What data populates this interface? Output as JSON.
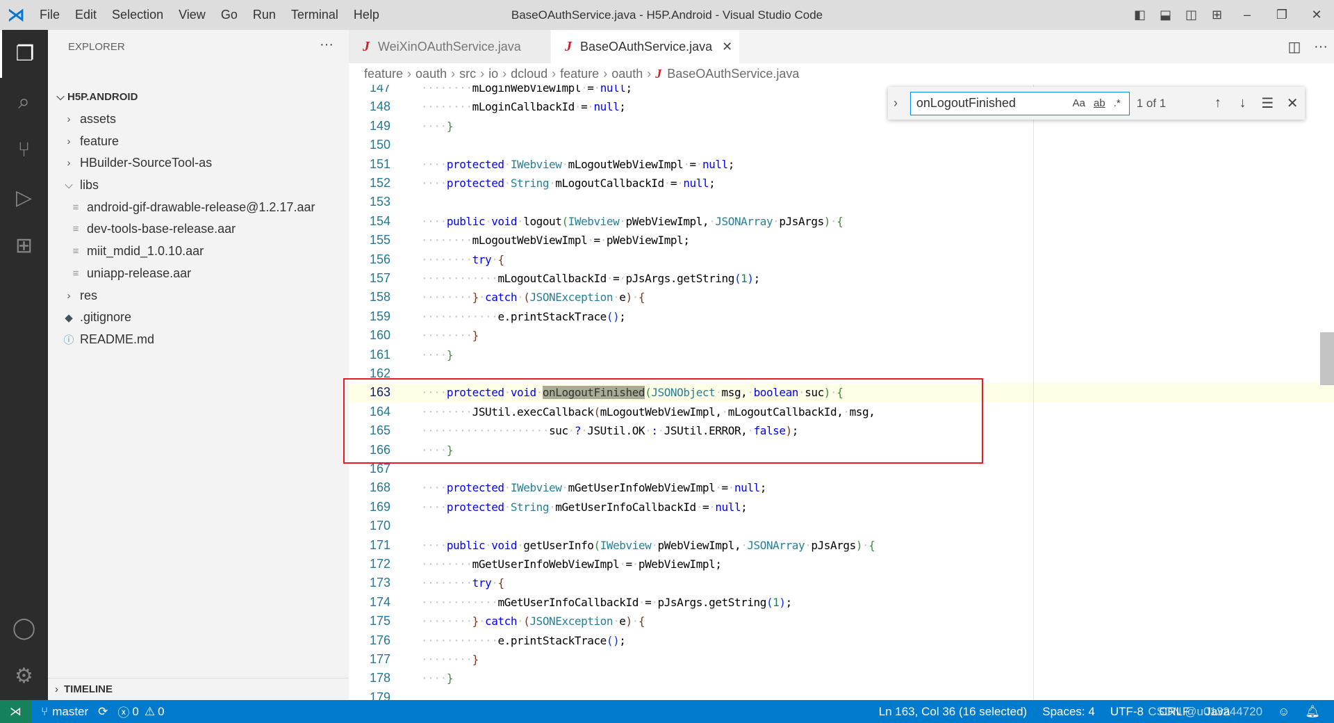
{
  "window": {
    "title": "BaseOAuthService.java - H5P.Android - Visual Studio Code",
    "menu": [
      "File",
      "Edit",
      "Selection",
      "View",
      "Go",
      "Run",
      "Terminal",
      "Help"
    ]
  },
  "sidebar": {
    "header": "EXPLORER",
    "root": "H5P.ANDROID",
    "items": [
      {
        "label": "assets",
        "type": "folder",
        "expanded": false,
        "depth": 1
      },
      {
        "label": "feature",
        "type": "folder",
        "expanded": false,
        "depth": 1
      },
      {
        "label": "HBuilder-SourceTool-as",
        "type": "folder",
        "expanded": false,
        "depth": 1
      },
      {
        "label": "libs",
        "type": "folder",
        "expanded": true,
        "depth": 1
      },
      {
        "label": "android-gif-drawable-release@1.2.17.aar",
        "type": "file",
        "depth": 2
      },
      {
        "label": "dev-tools-base-release.aar",
        "type": "file",
        "depth": 2
      },
      {
        "label": "miit_mdid_1.0.10.aar",
        "type": "file",
        "depth": 2
      },
      {
        "label": "uniapp-release.aar",
        "type": "file",
        "depth": 2
      },
      {
        "label": "res",
        "type": "folder",
        "expanded": false,
        "depth": 1
      },
      {
        "label": ".gitignore",
        "type": "git",
        "depth": 1
      },
      {
        "label": "README.md",
        "type": "info",
        "depth": 1
      }
    ],
    "timeline": "TIMELINE"
  },
  "tabs": [
    {
      "label": "WeiXinOAuthService.java",
      "active": false
    },
    {
      "label": "BaseOAuthService.java",
      "active": true
    }
  ],
  "breadcrumb": [
    "feature",
    "oauth",
    "src",
    "io",
    "dcloud",
    "feature",
    "oauth",
    "BaseOAuthService.java"
  ],
  "find": {
    "value": "onLogoutFinished",
    "match_case": "Aa",
    "whole_word": "ab",
    "regex": ".*",
    "count": "1 of 1"
  },
  "editor": {
    "current_line": 163,
    "lines": [
      {
        "n": 147,
        "t": [
          [
            "ws",
            "        "
          ],
          [
            "p",
            "mLoginWebViewImpl = "
          ],
          [
            "k",
            "null"
          ],
          [
            "p",
            ";"
          ]
        ]
      },
      {
        "n": 148,
        "t": [
          [
            "ws",
            "        "
          ],
          [
            "p",
            "mLoginCallbackId = "
          ],
          [
            "k",
            "null"
          ],
          [
            "p",
            ";"
          ]
        ]
      },
      {
        "n": 149,
        "t": [
          [
            "ws",
            "    "
          ],
          [
            "b2",
            "}"
          ]
        ]
      },
      {
        "n": 150,
        "t": []
      },
      {
        "n": 151,
        "t": [
          [
            "ws",
            "    "
          ],
          [
            "k",
            "protected"
          ],
          [
            "p",
            " "
          ],
          [
            "t",
            "IWebview"
          ],
          [
            "p",
            " mLogoutWebViewImpl = "
          ],
          [
            "k",
            "null"
          ],
          [
            "p",
            ";"
          ]
        ]
      },
      {
        "n": 152,
        "t": [
          [
            "ws",
            "    "
          ],
          [
            "k",
            "protected"
          ],
          [
            "p",
            " "
          ],
          [
            "t",
            "String"
          ],
          [
            "p",
            " mLogoutCallbackId = "
          ],
          [
            "k",
            "null"
          ],
          [
            "p",
            ";"
          ]
        ]
      },
      {
        "n": 153,
        "t": []
      },
      {
        "n": 154,
        "t": [
          [
            "ws",
            "    "
          ],
          [
            "k",
            "public"
          ],
          [
            "p",
            " "
          ],
          [
            "k",
            "void"
          ],
          [
            "p",
            " logout"
          ],
          [
            "b2",
            "("
          ],
          [
            "t",
            "IWebview"
          ],
          [
            "p",
            " pWebViewImpl, "
          ],
          [
            "t",
            "JSONArray"
          ],
          [
            "p",
            " pJsArgs"
          ],
          [
            "b2",
            ")"
          ],
          [
            "p",
            " "
          ],
          [
            "b2",
            "{"
          ]
        ]
      },
      {
        "n": 155,
        "t": [
          [
            "ws",
            "        "
          ],
          [
            "p",
            "mLogoutWebViewImpl = pWebViewImpl;"
          ]
        ]
      },
      {
        "n": 156,
        "t": [
          [
            "ws",
            "        "
          ],
          [
            "k",
            "try"
          ],
          [
            "p",
            " "
          ],
          [
            "b3",
            "{"
          ]
        ]
      },
      {
        "n": 157,
        "t": [
          [
            "ws",
            "            "
          ],
          [
            "p",
            "mLogoutCallbackId = pJsArgs.getString"
          ],
          [
            "b1",
            "("
          ],
          [
            "n",
            "1"
          ],
          [
            "b1",
            ")"
          ],
          [
            "p",
            ";"
          ]
        ]
      },
      {
        "n": 158,
        "t": [
          [
            "ws",
            "        "
          ],
          [
            "b3",
            "}"
          ],
          [
            "p",
            " "
          ],
          [
            "k",
            "catch"
          ],
          [
            "p",
            " "
          ],
          [
            "b3",
            "("
          ],
          [
            "t",
            "JSONException"
          ],
          [
            "p",
            " e"
          ],
          [
            "b3",
            ")"
          ],
          [
            "p",
            " "
          ],
          [
            "b3",
            "{"
          ]
        ]
      },
      {
        "n": 159,
        "t": [
          [
            "ws",
            "            "
          ],
          [
            "p",
            "e.printStackTrace"
          ],
          [
            "b1",
            "()"
          ],
          [
            "p",
            ";"
          ]
        ]
      },
      {
        "n": 160,
        "t": [
          [
            "ws",
            "        "
          ],
          [
            "b3",
            "}"
          ]
        ]
      },
      {
        "n": 161,
        "t": [
          [
            "ws",
            "    "
          ],
          [
            "b2",
            "}"
          ]
        ]
      },
      {
        "n": 162,
        "t": []
      },
      {
        "n": 163,
        "t": [
          [
            "ws",
            "    "
          ],
          [
            "k",
            "protected"
          ],
          [
            "p",
            " "
          ],
          [
            "k",
            "void"
          ],
          [
            "p",
            " "
          ],
          [
            "h",
            "onLogoutFinished"
          ],
          [
            "b2",
            "("
          ],
          [
            "t",
            "JSONObject"
          ],
          [
            "p",
            " msg, "
          ],
          [
            "k",
            "boolean"
          ],
          [
            "p",
            " suc"
          ],
          [
            "b2",
            ")"
          ],
          [
            "p",
            " "
          ],
          [
            "b2",
            "{"
          ]
        ]
      },
      {
        "n": 164,
        "t": [
          [
            "ws",
            "        "
          ],
          [
            "p",
            "JSUtil.execCallback"
          ],
          [
            "b3",
            "("
          ],
          [
            "p",
            "mLogoutWebViewImpl, mLogoutCallbackId, msg,"
          ]
        ]
      },
      {
        "n": 165,
        "t": [
          [
            "ws",
            "                    "
          ],
          [
            "p",
            "suc "
          ],
          [
            "k",
            "?"
          ],
          [
            "p",
            " JSUtil.OK "
          ],
          [
            "k",
            ":"
          ],
          [
            "p",
            " JSUtil.ERROR, "
          ],
          [
            "k",
            "false"
          ],
          [
            "b3",
            ")"
          ],
          [
            "p",
            ";"
          ]
        ]
      },
      {
        "n": 166,
        "t": [
          [
            "ws",
            "    "
          ],
          [
            "b2",
            "}"
          ]
        ]
      },
      {
        "n": 167,
        "t": []
      },
      {
        "n": 168,
        "t": [
          [
            "ws",
            "    "
          ],
          [
            "k",
            "protected"
          ],
          [
            "p",
            " "
          ],
          [
            "t",
            "IWebview"
          ],
          [
            "p",
            " mGetUserInfoWebViewImpl = "
          ],
          [
            "k",
            "null"
          ],
          [
            "p",
            ";"
          ]
        ]
      },
      {
        "n": 169,
        "t": [
          [
            "ws",
            "    "
          ],
          [
            "k",
            "protected"
          ],
          [
            "p",
            " "
          ],
          [
            "t",
            "String"
          ],
          [
            "p",
            " mGetUserInfoCallbackId = "
          ],
          [
            "k",
            "null"
          ],
          [
            "p",
            ";"
          ]
        ]
      },
      {
        "n": 170,
        "t": []
      },
      {
        "n": 171,
        "t": [
          [
            "ws",
            "    "
          ],
          [
            "k",
            "public"
          ],
          [
            "p",
            " "
          ],
          [
            "k",
            "void"
          ],
          [
            "p",
            " getUserInfo"
          ],
          [
            "b2",
            "("
          ],
          [
            "t",
            "IWebview"
          ],
          [
            "p",
            " pWebViewImpl, "
          ],
          [
            "t",
            "JSONArray"
          ],
          [
            "p",
            " pJsArgs"
          ],
          [
            "b2",
            ")"
          ],
          [
            "p",
            " "
          ],
          [
            "b2",
            "{"
          ]
        ]
      },
      {
        "n": 172,
        "t": [
          [
            "ws",
            "        "
          ],
          [
            "p",
            "mGetUserInfoWebViewImpl = pWebViewImpl;"
          ]
        ]
      },
      {
        "n": 173,
        "t": [
          [
            "ws",
            "        "
          ],
          [
            "k",
            "try"
          ],
          [
            "p",
            " "
          ],
          [
            "b3",
            "{"
          ]
        ]
      },
      {
        "n": 174,
        "t": [
          [
            "ws",
            "            "
          ],
          [
            "p",
            "mGetUserInfoCallbackId = pJsArgs.getString"
          ],
          [
            "b1",
            "("
          ],
          [
            "n",
            "1"
          ],
          [
            "b1",
            ")"
          ],
          [
            "p",
            ";"
          ]
        ]
      },
      {
        "n": 175,
        "t": [
          [
            "ws",
            "        "
          ],
          [
            "b3",
            "}"
          ],
          [
            "p",
            " "
          ],
          [
            "k",
            "catch"
          ],
          [
            "p",
            " "
          ],
          [
            "b3",
            "("
          ],
          [
            "t",
            "JSONException"
          ],
          [
            "p",
            " e"
          ],
          [
            "b3",
            ")"
          ],
          [
            "p",
            " "
          ],
          [
            "b3",
            "{"
          ]
        ]
      },
      {
        "n": 176,
        "t": [
          [
            "ws",
            "            "
          ],
          [
            "p",
            "e.printStackTrace"
          ],
          [
            "b1",
            "()"
          ],
          [
            "p",
            ";"
          ]
        ]
      },
      {
        "n": 177,
        "t": [
          [
            "ws",
            "        "
          ],
          [
            "b3",
            "}"
          ]
        ]
      },
      {
        "n": 178,
        "t": [
          [
            "ws",
            "    "
          ],
          [
            "b2",
            "}"
          ]
        ]
      },
      {
        "n": 179,
        "t": []
      }
    ]
  },
  "status": {
    "branch": "master",
    "errors": "0",
    "warnings": "0",
    "cursor": "Ln 163, Col 36 (16 selected)",
    "spaces": "Spaces: 4",
    "encoding": "UTF-8",
    "eol": "CRLF",
    "language": "Java",
    "watermark": "CSDN @u013244720"
  },
  "colors": {
    "accent": "#007acc",
    "highlight_box": "#e51c23",
    "find_match": "#a8ac94"
  }
}
